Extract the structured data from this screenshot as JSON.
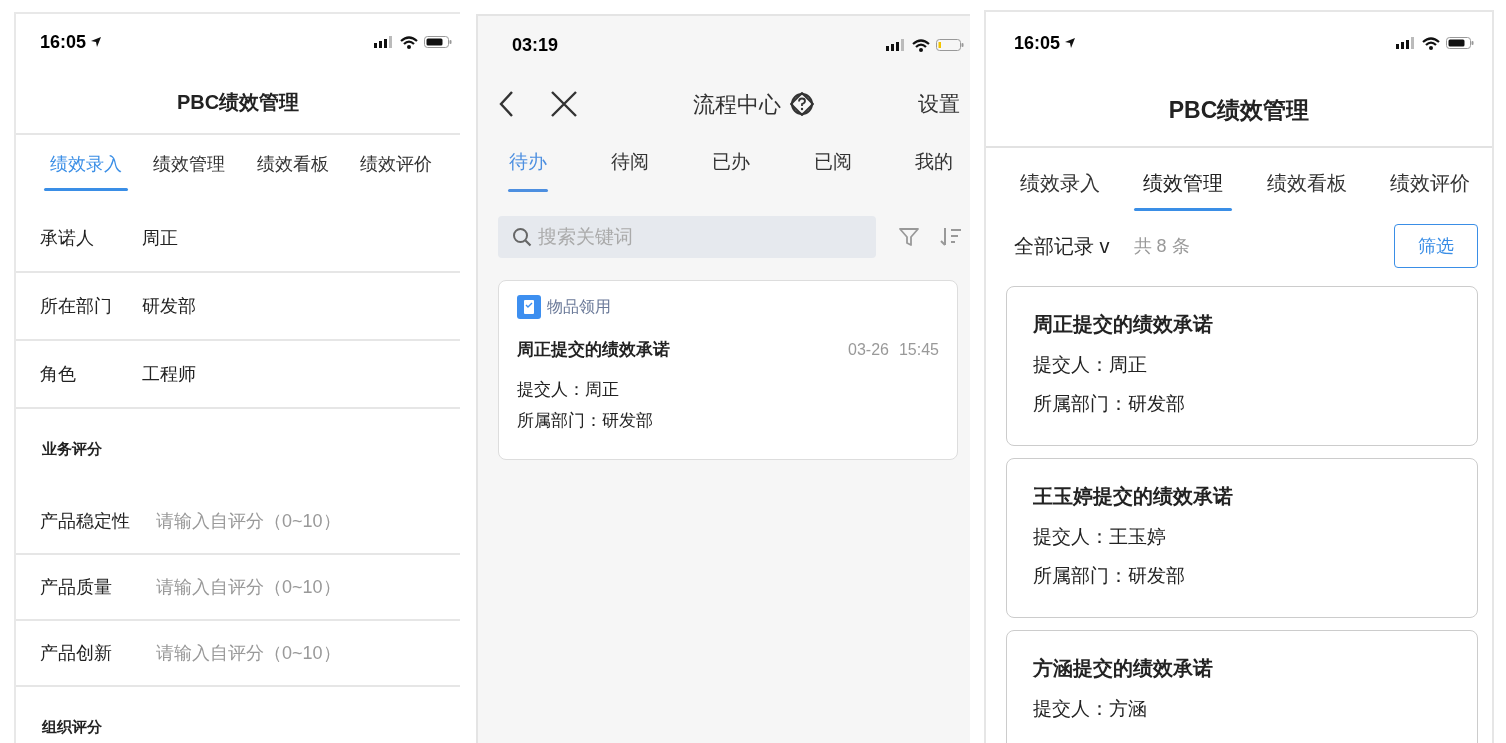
{
  "screens": [
    {
      "kind": "form",
      "status_bar": {
        "time": "16:05"
      },
      "title": "PBC绩效管理",
      "tabs": [
        {
          "label": "绩效录入",
          "selected": true
        },
        {
          "label": "绩效管理",
          "selected": false
        },
        {
          "label": "绩效看板",
          "selected": false
        },
        {
          "label": "绩效评价",
          "selected": false
        }
      ],
      "info_rows": [
        {
          "label": "承诺人",
          "value": "周正"
        },
        {
          "label": "所在部门",
          "value": "研发部"
        },
        {
          "label": "角色",
          "value": "工程师"
        }
      ],
      "sections": [
        {
          "heading": "业务评分",
          "items": [
            {
              "label": "产品稳定性",
              "placeholder": "请输入自评分（0~10）"
            },
            {
              "label": "产品质量",
              "placeholder": "请输入自评分（0~10）"
            },
            {
              "label": "产品创新",
              "placeholder": "请输入自评分（0~10）"
            }
          ]
        },
        {
          "heading": "组织评分"
        }
      ]
    },
    {
      "kind": "inbox",
      "status_bar": {
        "time": "03:19"
      },
      "title": "流程中心",
      "settings": "设置",
      "tabs": [
        {
          "label": "待办",
          "selected": true
        },
        {
          "label": "待阅",
          "selected": false
        },
        {
          "label": "已办",
          "selected": false
        },
        {
          "label": "已阅",
          "selected": false
        },
        {
          "label": "我的",
          "selected": false
        }
      ],
      "search": {
        "placeholder": "搜索关键词"
      },
      "cards": [
        {
          "category": "物品领用",
          "title": "周正提交的绩效承诺",
          "date": "03-26",
          "time": "15:45",
          "lines": [
            "提交人：周正",
            "所属部门：研发部"
          ]
        }
      ]
    },
    {
      "kind": "list",
      "status_bar": {
        "time": "16:05"
      },
      "title": "PBC绩效管理",
      "tabs": [
        {
          "label": "绩效录入",
          "selected": false
        },
        {
          "label": "绩效管理",
          "selected": true
        },
        {
          "label": "绩效看板",
          "selected": false
        },
        {
          "label": "绩效评价",
          "selected": false
        }
      ],
      "filter_label": "全部记录 v",
      "count": "共 8 条",
      "filter_button": "筛选",
      "cards": [
        {
          "title": "周正提交的绩效承诺",
          "lines": [
            "提交人：周正",
            "所属部门：研发部"
          ]
        },
        {
          "title": "王玉婷提交的绩效承诺",
          "lines": [
            "提交人：王玉婷",
            "所属部门：研发部"
          ]
        },
        {
          "title": "方涵提交的绩效承诺",
          "lines": [
            "提交人：方涵"
          ]
        }
      ]
    }
  ]
}
